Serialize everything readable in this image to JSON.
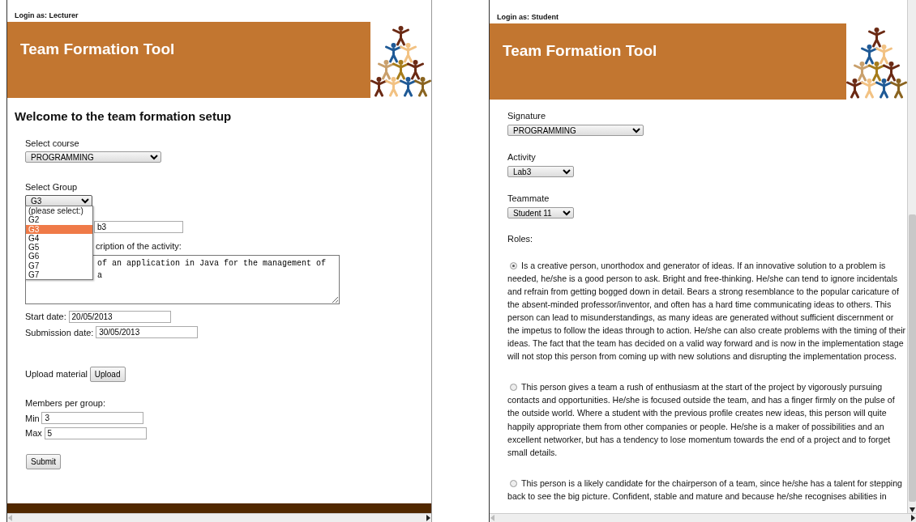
{
  "lecturer_window": {
    "login_label": "Login as: Lecturer",
    "banner_title": "Team Formation Tool",
    "heading": "Welcome to the team formation setup",
    "course": {
      "label": "Select course",
      "value": "PROGRAMMING"
    },
    "group": {
      "label": "Select Group",
      "value": "G3",
      "expanded": true,
      "options": [
        {
          "label": "(please select:)",
          "selected": false
        },
        {
          "label": "G2",
          "selected": false
        },
        {
          "label": "G3",
          "selected": true
        },
        {
          "label": "G4",
          "selected": false
        },
        {
          "label": "G5",
          "selected": false
        },
        {
          "label": "G6",
          "selected": false
        },
        {
          "label": "G7",
          "selected": false
        },
        {
          "label": "G7",
          "selected": false
        }
      ]
    },
    "activity_value": "b3",
    "description_label": "cription of the activity:",
    "description_text": "of an application in Java for the management of a",
    "start_date": {
      "label": "Start date:",
      "value": "20/05/2013"
    },
    "submission_date": {
      "label": "Submission date:",
      "value": "30/05/2013"
    },
    "upload": {
      "label": "Upload material",
      "button": "Upload"
    },
    "members": {
      "label": "Members per group:",
      "min": {
        "label": "Min",
        "value": "3"
      },
      "max": {
        "label": "Max",
        "value": "5"
      }
    },
    "submit": "Submit"
  },
  "student_window": {
    "login_label": "Login as: Student",
    "banner_title": "Team Formation Tool",
    "fields": [
      {
        "label": "Signature",
        "value": "PROGRAMMING",
        "wide": true
      },
      {
        "label": "Activity",
        "value": "Lab3",
        "wide": false
      },
      {
        "label": "Teammate",
        "value": "Student 11",
        "wide": false
      }
    ],
    "roles_label": "Roles:",
    "roles": [
      {
        "selected": true,
        "text": "Is a creative person, unorthodox and generator of ideas. If an innovative solution to a problem is needed, he/she is a good person to ask. Bright and free-thinking. He/she can tend to ignore incidentals and refrain from getting bogged down in detail. Bears a strong resemblance to the popular caricature of the absent-minded professor/inventor, and often has a hard time communicating ideas to others. This person can lead to misunderstandings, as many ideas are generated without sufficient discernment or the impetus to follow the ideas through to action. He/she can also create problems with the timing of their ideas. The fact that the team has decided on a valid way forward and is now in the implementation stage will not stop this person from coming up with new solutions and disrupting the implementation process."
      },
      {
        "selected": false,
        "text": "This person gives a team a rush of enthusiasm at the start of the project by vigorously pursuing contacts and opportunities. He/she is focused outside the team, and has a finger firmly on the pulse of the outside world. Where a student with the previous profile creates new ideas, this person will quite happily appropriate them from other companies or people. He/she is a maker of possibilities and an excellent networker, but has a tendency to lose momentum towards the end of a project and to forget small details."
      },
      {
        "selected": false,
        "text": "This person is a likely candidate for the chairperson of a team, since he/she has a talent for stepping back to see the big picture. Confident, stable and mature and because he/she recognises abilities in"
      }
    ]
  }
}
